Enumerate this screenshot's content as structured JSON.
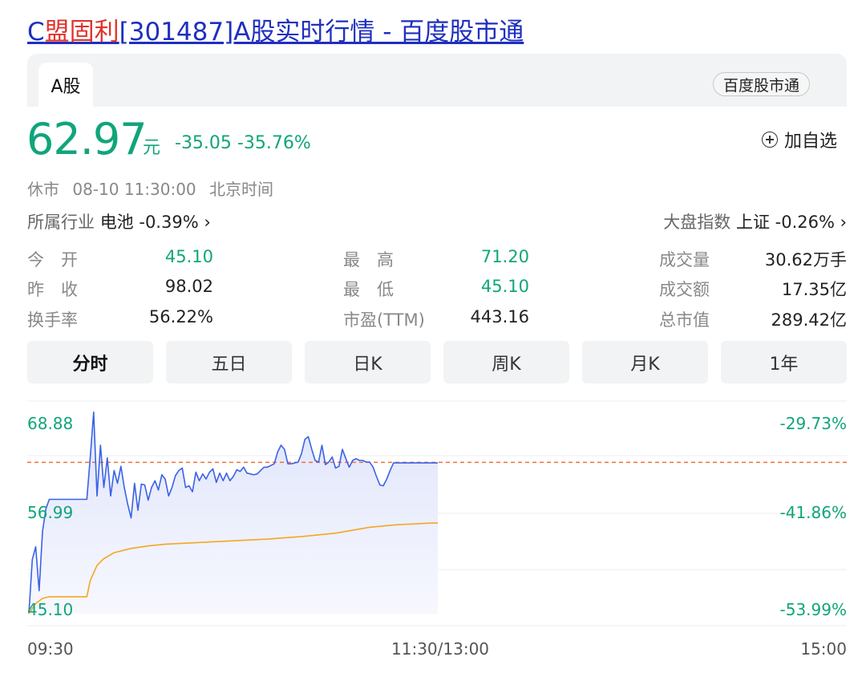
{
  "page": {
    "title_prefix": "C",
    "title_highlight": "盟固利",
    "title_suffix": "[301487]A股实时行情 - 百度股市通"
  },
  "tabs": {
    "active": "A股",
    "source_badge": "百度股市通"
  },
  "quote": {
    "price": "62.97",
    "unit": "元",
    "change": "-35.05 -35.76%",
    "add_watchlist": "加自选",
    "status": "休市",
    "datetime": "08-10 11:30:00",
    "timezone": "北京时间",
    "industry_label": "所属行业",
    "industry_value": "电池 -0.39% ›",
    "index_label": "大盘指数",
    "index_value": "上证 -0.26% ›"
  },
  "stats": [
    {
      "label": "今　开",
      "value": "45.10",
      "color": "#10a57a"
    },
    {
      "label": "最　高",
      "value": "71.20",
      "color": "#10a57a"
    },
    {
      "label": "成交量",
      "value": "30.62万手",
      "color": "#222222"
    },
    {
      "label": "昨　收",
      "value": "98.02",
      "color": "#222222"
    },
    {
      "label": "最　低",
      "value": "45.10",
      "color": "#10a57a"
    },
    {
      "label": "成交额",
      "value": "17.35亿",
      "color": "#222222"
    },
    {
      "label": "换手率",
      "value": "56.22%",
      "color": "#222222"
    },
    {
      "label": "市盈(TTM)",
      "value": "443.16",
      "color": "#222222"
    },
    {
      "label": "总市值",
      "value": "289.42亿",
      "color": "#222222"
    }
  ],
  "range_tabs": [
    "分时",
    "五日",
    "日K",
    "周K",
    "月K",
    "1年"
  ],
  "chart_data": {
    "type": "line",
    "y_left_ticks": [
      "68.88",
      "56.99",
      "45.10"
    ],
    "y_right_ticks": [
      "-29.73%",
      "-41.86%",
      "-53.99%"
    ],
    "x_ticks": [
      "09:30",
      "11:30/13:00",
      "15:00"
    ],
    "ylim": [
      45.1,
      68.88
    ],
    "prev_close_line": 62.97,
    "series": [
      {
        "color": "#3a62e6",
        "x": [
          0,
          1,
          2,
          3,
          4,
          5,
          6,
          7,
          8,
          9,
          10,
          11,
          12,
          13,
          14,
          15,
          16,
          17,
          18,
          19,
          20,
          21,
          22,
          23,
          24,
          25,
          26,
          27,
          28,
          29,
          30,
          31,
          32,
          33,
          34,
          35,
          36,
          37,
          38,
          39,
          40,
          41,
          42,
          43,
          44,
          45,
          46,
          47,
          48,
          49,
          50,
          51,
          52,
          53,
          54,
          55,
          56,
          57,
          58,
          59,
          60,
          61,
          62,
          63,
          64,
          65,
          66,
          67,
          68,
          69,
          70,
          71,
          72,
          73,
          74,
          75,
          76,
          77,
          78,
          79,
          80,
          81,
          82,
          83,
          84,
          85,
          86,
          87,
          88,
          89,
          90,
          91,
          92,
          93,
          94,
          95,
          96,
          97,
          98,
          99,
          100,
          101,
          102,
          103,
          104,
          105,
          106,
          107,
          108,
          109,
          110,
          111,
          112,
          113,
          114,
          115,
          116,
          117,
          118,
          119,
          120
        ],
        "y": [
          45.1,
          51.5,
          53.0,
          47.8,
          54.8,
          57.5,
          58.6,
          58.6,
          58.6,
          58.6,
          58.6,
          58.6,
          58.6,
          58.6,
          58.6,
          58.6,
          58.6,
          58.6,
          63.5,
          68.9,
          59.0,
          65.0,
          60.0,
          63.5,
          59.0,
          62.0,
          60.5,
          62.5,
          60.0,
          58.0,
          56.4,
          60.5,
          57.3,
          60.4,
          60.3,
          58.5,
          60.0,
          60.8,
          59.7,
          61.5,
          61.0,
          59.0,
          60.0,
          61.4,
          62.0,
          62.3,
          60.0,
          60.2,
          59.5,
          61.8,
          60.8,
          61.6,
          61.0,
          61.8,
          62.2,
          60.6,
          61.7,
          60.8,
          61.7,
          60.8,
          61.3,
          62.1,
          61.9,
          62.4,
          61.7,
          61.6,
          61.5,
          61.6,
          62.0,
          62.4,
          62.4,
          62.6,
          62.8,
          64.2,
          65.0,
          64.5,
          62.8,
          62.8,
          62.9,
          63.0,
          64.0,
          65.7,
          66.0,
          64.5,
          63.2,
          63.0,
          65.0,
          62.7,
          63.0,
          63.6,
          62.3,
          62.5,
          64.5,
          63.4,
          62.4,
          63.2,
          63.4,
          63.2,
          63.2,
          63.0,
          63.0,
          62.4,
          61.3,
          60.3,
          60.2,
          61.0,
          62.0,
          62.9,
          62.9,
          62.9,
          62.9,
          62.9,
          62.9,
          62.9,
          62.9,
          62.9,
          62.9,
          62.9,
          62.9,
          62.9,
          62.9
        ]
      },
      {
        "color": "#f5a623",
        "x": [
          0,
          2,
          4,
          6,
          8,
          10,
          12,
          14,
          16,
          17,
          18,
          20,
          22,
          25,
          30,
          35,
          40,
          50,
          60,
          70,
          80,
          90,
          100,
          108,
          118,
          120
        ],
        "y": [
          45.1,
          46.3,
          46.9,
          47.1,
          47.1,
          47.1,
          47.1,
          47.1,
          47.1,
          47.1,
          49.0,
          50.8,
          51.6,
          52.3,
          52.8,
          53.1,
          53.3,
          53.5,
          53.7,
          53.9,
          54.2,
          54.6,
          55.3,
          55.6,
          55.8,
          55.8
        ]
      }
    ],
    "x_points_used": 120,
    "x_points_total": 240
  }
}
